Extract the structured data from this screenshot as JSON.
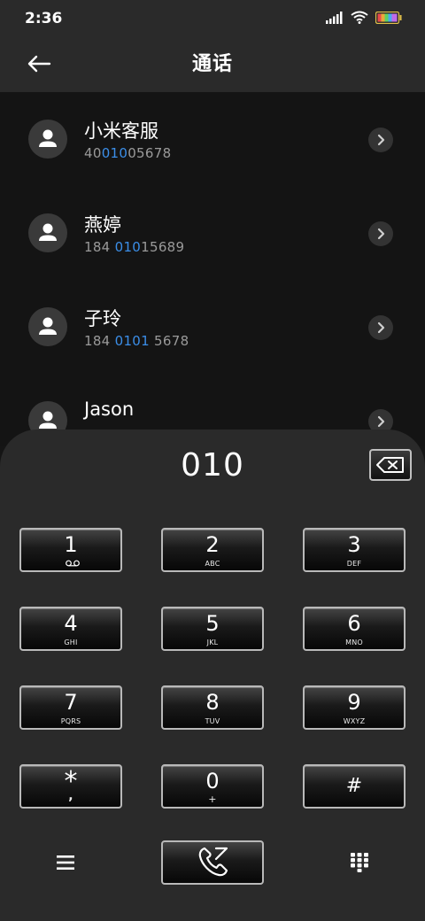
{
  "status_bar": {
    "time": "2:36"
  },
  "header": {
    "title": "通话"
  },
  "contacts": [
    {
      "name": "小米客服",
      "number_parts": [
        "40",
        "010",
        "05678"
      ]
    },
    {
      "name": "燕婷",
      "number_parts": [
        "184 ",
        "010",
        "15689"
      ]
    },
    {
      "name": "子玲",
      "number_parts": [
        "184 ",
        "0101",
        " 5678"
      ]
    },
    {
      "name": "Jason",
      "number_parts": [
        "",
        "",
        ""
      ]
    }
  ],
  "dialpad": {
    "display": "010",
    "keys": [
      {
        "digit": "1",
        "letters": "voicemail"
      },
      {
        "digit": "2",
        "letters": "ABC"
      },
      {
        "digit": "3",
        "letters": "DEF"
      },
      {
        "digit": "4",
        "letters": "GHI"
      },
      {
        "digit": "5",
        "letters": "JKL"
      },
      {
        "digit": "6",
        "letters": "MNO"
      },
      {
        "digit": "7",
        "letters": "PQRS"
      },
      {
        "digit": "8",
        "letters": "TUV"
      },
      {
        "digit": "9",
        "letters": "WXYZ"
      },
      {
        "digit": "*",
        "letters": ","
      },
      {
        "digit": "0",
        "letters": "+"
      },
      {
        "digit": "#",
        "letters": ""
      }
    ]
  },
  "icons": {
    "back": "back-arrow-icon",
    "contact": "person-icon",
    "chevron": "chevron-right-icon",
    "backspace": "backspace-icon",
    "menu": "menu-icon",
    "call": "phone-icon",
    "keypad": "dialpad-icon"
  },
  "colors": {
    "highlight": "#3b8ee8",
    "background": "#151515",
    "panel": "#2a2a2a"
  }
}
